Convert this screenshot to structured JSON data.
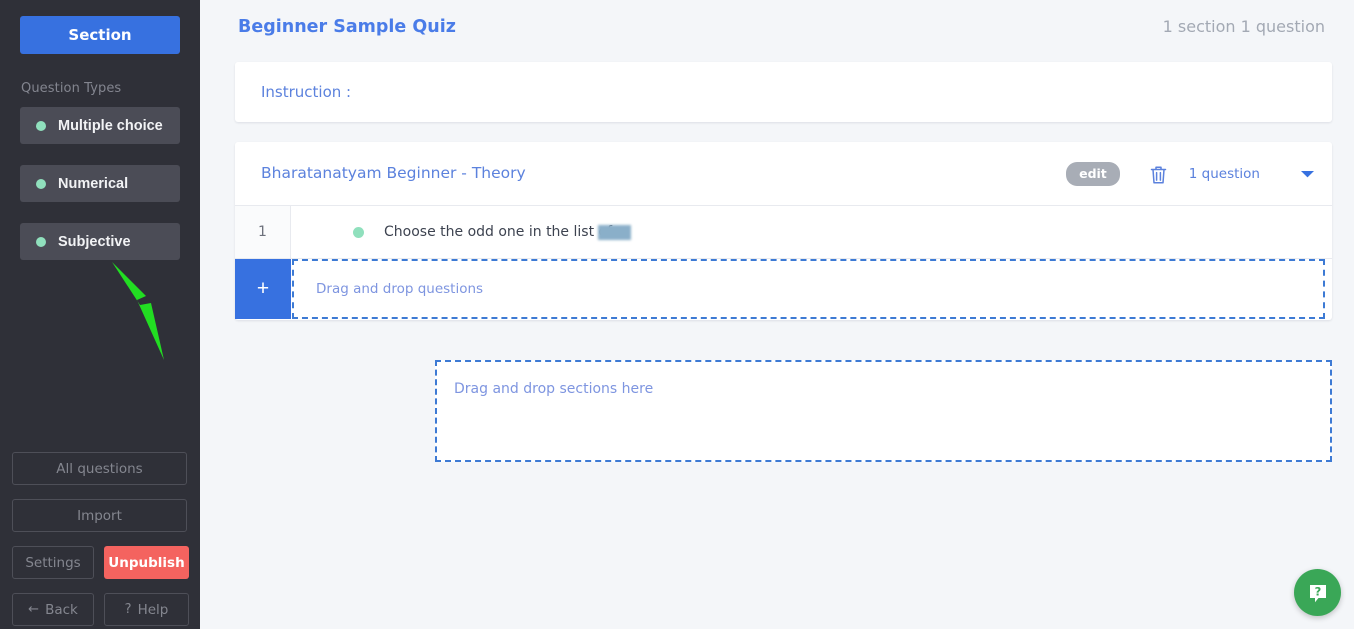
{
  "sidebar": {
    "section_button": "Section",
    "question_types_label": "Question Types",
    "question_types": [
      {
        "label": "Multiple choice",
        "dot_icon": "status-dot-icon"
      },
      {
        "label": "Numerical",
        "dot_icon": "status-dot-icon"
      },
      {
        "label": "Subjective",
        "dot_icon": "status-dot-icon"
      }
    ],
    "all_questions_button": "All questions",
    "import_button": "Import",
    "settings_button": "Settings",
    "unpublish_button": "Unpublish",
    "back_button": "Back",
    "back_icon": "arrow-left-icon",
    "help_button": "Help",
    "help_icon": "question-mark-icon",
    "annotation_arrow": "green-arrow-annotation"
  },
  "header": {
    "title": "Beginner Sample Quiz",
    "summary": "1 section 1 question"
  },
  "instruction": {
    "label": "Instruction :"
  },
  "section": {
    "title": "Bharatanatyam Beginner - Theory",
    "edit_label": "edit",
    "delete_icon": "trash-icon",
    "question_count": "1 question",
    "chevron_icon": "chevron-down-icon",
    "questions": [
      {
        "number": "1",
        "type_dot": "status-dot-icon",
        "text": "Choose the odd one in the list of ..."
      }
    ],
    "add_question_label": "+",
    "dropzone_questions": "Drag and drop questions"
  },
  "dropzone_sections": "Drag and drop sections here",
  "help_fab": {
    "icon": "chat-help-icon"
  },
  "colors": {
    "sidebar_bg": "#2f3038",
    "accent_blue": "#3771e0",
    "link_blue": "#5c82dd",
    "danger_red": "#f4635f",
    "dot_green": "#90e0bd",
    "fab_green": "#3aa757",
    "page_bg": "#f4f6f9",
    "annotation_green": "#22dd22"
  }
}
